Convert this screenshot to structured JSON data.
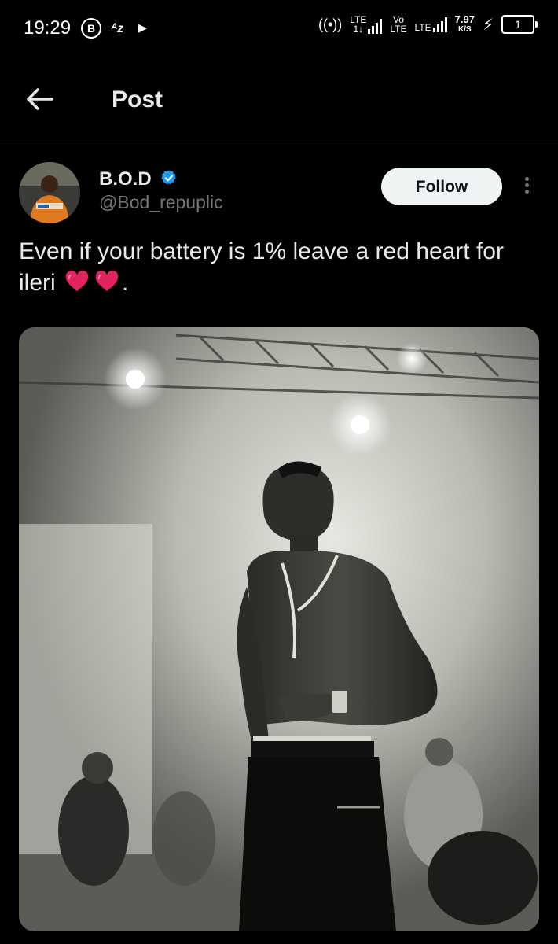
{
  "status_bar": {
    "time": "19:29",
    "notif_b": "B",
    "notif_az": "ᴬz",
    "network_1": "LTE",
    "network_1_sub": "1↓",
    "volte": "Vo",
    "volte_sub": "LTE",
    "network_2": "LTE",
    "speed_value": "7.97",
    "speed_unit": "K/S",
    "battery": "1"
  },
  "header": {
    "title": "Post"
  },
  "post": {
    "author_name": "B.O.D",
    "author_handle": "@Bod_repuplic",
    "follow_label": "Follow",
    "text_before": "Even if your battery is 1% leave a red heart for ileri ",
    "text_after": ".",
    "accent_color": "#1d9bf0",
    "heart_color": "#e0245e"
  },
  "icons": [
    "back-arrow-icon",
    "verified-badge-icon",
    "more-options-icon",
    "heart-icon",
    "wifi-hotspot-icon",
    "charging-icon"
  ]
}
